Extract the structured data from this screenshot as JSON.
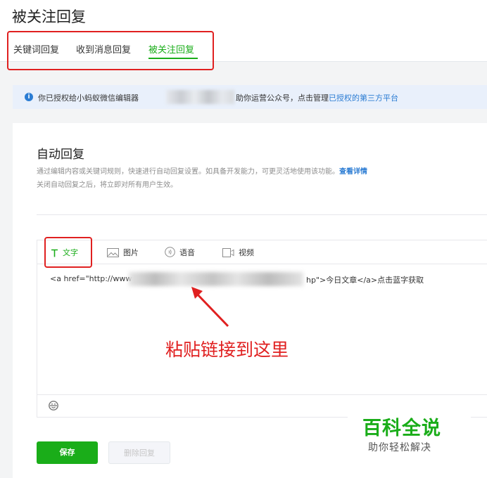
{
  "page_title": "被关注回复",
  "tabs": [
    {
      "label": "关键词回复",
      "active": false
    },
    {
      "label": "收到消息回复",
      "active": false
    },
    {
      "label": "被关注回复",
      "active": true
    }
  ],
  "notice": {
    "icon": "info-icon",
    "pre": "你已授权给小蚂蚁微信编辑器",
    "post": "助你运营公众号，点击管理",
    "link": "已授权的第三方平台"
  },
  "section": {
    "title": "自动回复",
    "desc_line1": "通过编辑内容或关键词规则，快速进行自动回复设置。如具备开发能力，可更灵活地使用该功能。",
    "desc_link": "查看详情",
    "desc_line2": "关闭自动回复之后，将立即对所有用户生效。"
  },
  "editor": {
    "tools": [
      {
        "label": "文字",
        "icon": "text-icon",
        "active": true
      },
      {
        "label": "图片",
        "icon": "image-icon",
        "active": false
      },
      {
        "label": "语音",
        "icon": "voice-icon",
        "active": false
      },
      {
        "label": "视频",
        "icon": "video-icon",
        "active": false
      }
    ],
    "content_prefix": "<a href=\"http://www",
    "content_suffix": "hp\">今日文章</a>点击蓝字获取",
    "footer_icon": "emoji-icon"
  },
  "buttons": {
    "save": "保存",
    "delete": "删除回复"
  },
  "annotation": "粘贴链接到这里",
  "watermark": {
    "title": "百科全说",
    "subtitle": "助你轻松解决"
  },
  "colors": {
    "accent_green": "#1aad19",
    "link_blue": "#2b7cd3",
    "annotation_red": "#e02020"
  }
}
